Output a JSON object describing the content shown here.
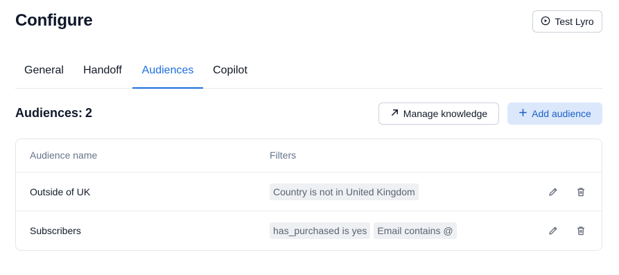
{
  "header": {
    "title": "Configure",
    "test_button_label": "Test Lyro"
  },
  "tabs": [
    {
      "label": "General",
      "active": false
    },
    {
      "label": "Handoff",
      "active": false
    },
    {
      "label": "Audiences",
      "active": true
    },
    {
      "label": "Copilot",
      "active": false
    }
  ],
  "audiences": {
    "heading": "Audiences:",
    "count": "2",
    "manage_button_label": "Manage knowledge",
    "add_button_label": "Add audience"
  },
  "table": {
    "columns": [
      "Audience name",
      "Filters"
    ],
    "rows": [
      {
        "name": "Outside of UK",
        "filters": [
          "Country is not in United Kingdom"
        ]
      },
      {
        "name": "Subscribers",
        "filters": [
          "has_purchased is yes",
          "Email contains @"
        ]
      }
    ]
  },
  "colors": {
    "accent": "#1d6fe0",
    "primary_button_bg": "#dbe8fb",
    "chip_bg": "#eef0f3"
  },
  "icons": {
    "test_button": "play-circle-icon",
    "manage_button": "arrow-up-right-icon",
    "add_button": "plus-icon",
    "row_edit": "pencil-icon",
    "row_delete": "trash-icon"
  }
}
